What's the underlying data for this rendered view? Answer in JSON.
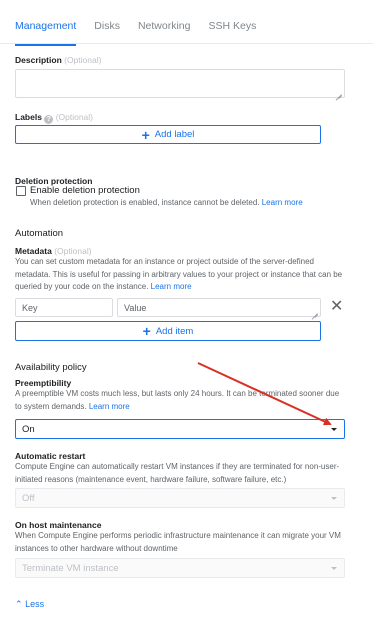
{
  "tabs": [
    {
      "label": "Management"
    },
    {
      "label": "Disks"
    },
    {
      "label": "Networking"
    },
    {
      "label": "SSH Keys"
    }
  ],
  "description": {
    "label": "Description",
    "optional": "(Optional)"
  },
  "labels": {
    "label": "Labels",
    "optional": "(Optional)",
    "add_button": "Add label"
  },
  "deletion": {
    "heading": "Deletion protection",
    "checkbox_label": "Enable deletion protection",
    "help": "When deletion protection is enabled, instance cannot be deleted.",
    "link": "Learn more"
  },
  "automation": {
    "heading": "Automation"
  },
  "metadata": {
    "label": "Metadata",
    "optional": "(Optional)",
    "help": "You can set custom metadata for an instance or project outside of the server-defined metadata. This is useful for passing in arbitrary values to your project or instance that can be queried by your code on the instance.",
    "link": "Learn more",
    "key_placeholder": "Key",
    "value_placeholder": "Value",
    "add_button": "Add item"
  },
  "availability": {
    "heading": "Availability policy",
    "preemptibility": {
      "label": "Preemptibility",
      "help": "A preemptible VM costs much less, but lasts only 24 hours. It can be terminated sooner due to system demands.",
      "link": "Learn more",
      "value": "On"
    },
    "restart": {
      "label": "Automatic restart",
      "help": "Compute Engine can automatically restart VM instances if they are terminated for non-user-initiated reasons (maintenance event, hardware failure, software failure, etc.)",
      "value": "Off"
    },
    "maintenance": {
      "label": "On host maintenance",
      "help": "When Compute Engine performs periodic infrastructure maintenance it can migrate your VM instances to other hardware without downtime",
      "value": "Terminate VM instance"
    }
  },
  "less_toggle": {
    "label": "Less"
  },
  "colors": {
    "accent": "#1a73e8",
    "annotation_arrow": "#d93025"
  }
}
